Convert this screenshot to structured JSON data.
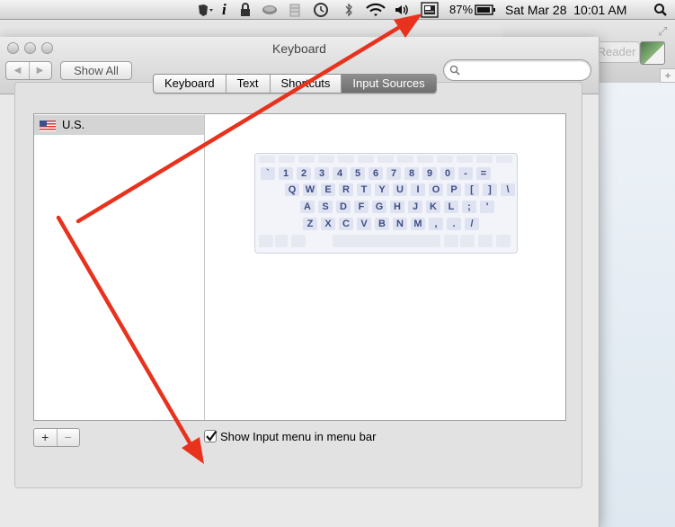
{
  "menubar": {
    "battery_percent": "87%",
    "clock": "Sat Mar 28  10:01 AM",
    "icons": [
      "evernote-icon",
      "info-icon",
      "lock-icon",
      "drive-icon",
      "stacks-icon",
      "time-machine-icon",
      "bluetooth-icon",
      "wifi-icon",
      "volume-icon",
      "input-menu-icon",
      "battery-icon",
      "spotlight-icon"
    ]
  },
  "background_window": {
    "reader_label": "Reader"
  },
  "window": {
    "title": "Keyboard",
    "show_all": "Show All",
    "back_symbol": "◀",
    "forward_symbol": "▶",
    "search": {
      "placeholder": "",
      "value": ""
    }
  },
  "tabs": [
    {
      "label": "Keyboard",
      "selected": false
    },
    {
      "label": "Text",
      "selected": false
    },
    {
      "label": "Shortcuts",
      "selected": false
    },
    {
      "label": "Input Sources",
      "selected": true
    }
  ],
  "input_sources": [
    {
      "label": "U.S.",
      "selected": true
    }
  ],
  "keyboard_rows": [
    [
      "`",
      "1",
      "2",
      "3",
      "4",
      "5",
      "6",
      "7",
      "8",
      "9",
      "0",
      "-",
      "="
    ],
    [
      "Q",
      "W",
      "E",
      "R",
      "T",
      "Y",
      "U",
      "I",
      "O",
      "P",
      "[",
      "]",
      "\\"
    ],
    [
      "A",
      "S",
      "D",
      "F",
      "G",
      "H",
      "J",
      "K",
      "L",
      ";",
      "'"
    ],
    [
      "Z",
      "X",
      "C",
      "V",
      "B",
      "N",
      "M",
      ",",
      ".",
      "/"
    ]
  ],
  "list_buttons": {
    "add": "+",
    "remove": "−"
  },
  "checkbox": {
    "label": "Show Input menu in menu bar",
    "checked": true
  },
  "colors": {
    "arrow": "#e8321e",
    "selected_tab": "#7d7d7d",
    "key_text": "#3c4e86"
  }
}
